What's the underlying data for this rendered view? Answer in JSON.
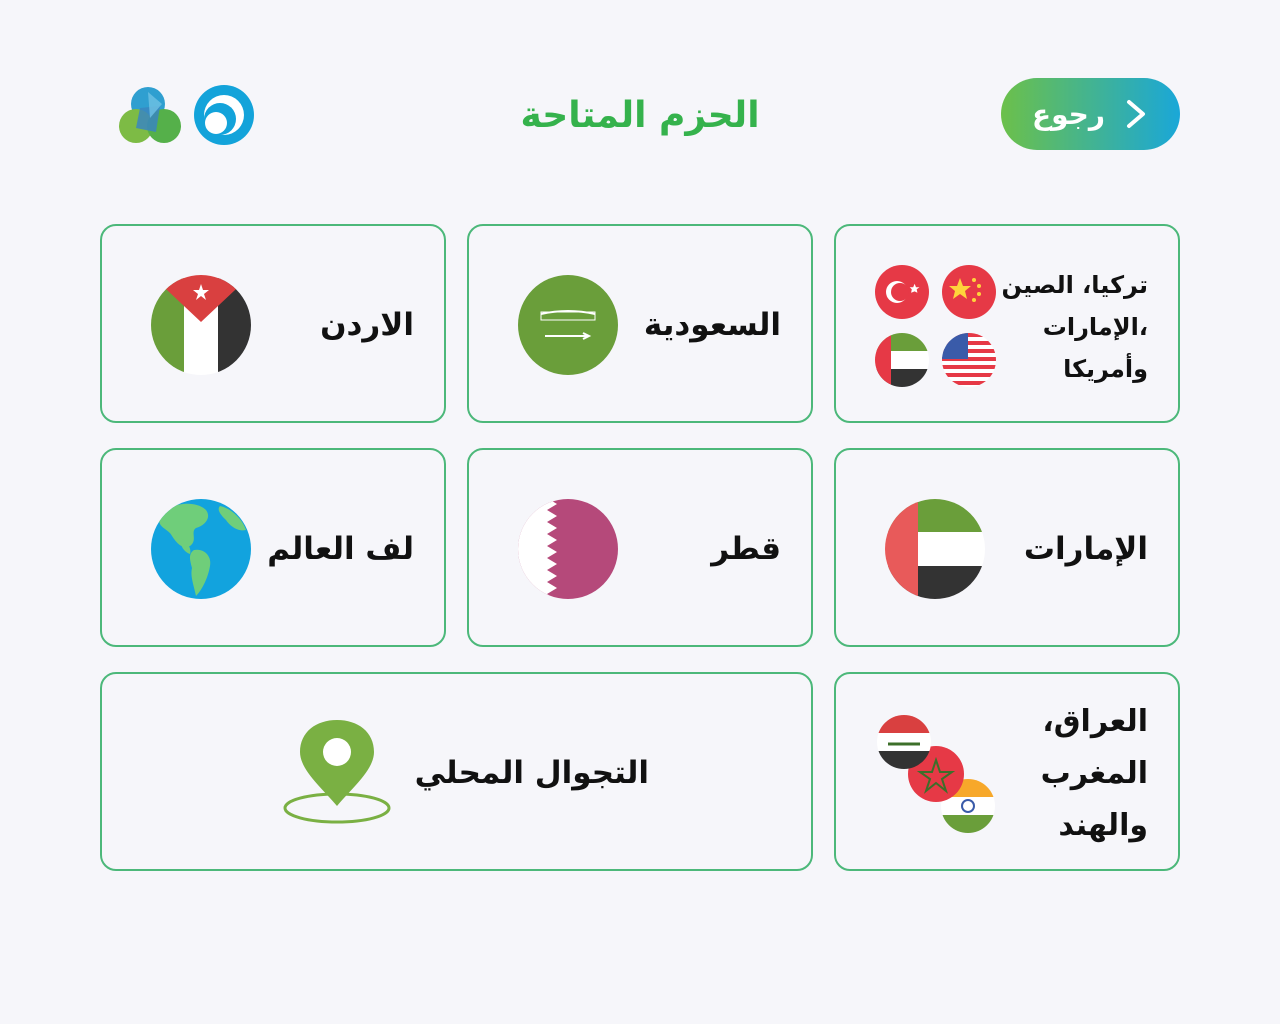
{
  "header": {
    "title": "الحزم المتاحة",
    "back_label": "رجوع",
    "logos": [
      "brand-logo-flower",
      "brand-logo-ring"
    ]
  },
  "colors": {
    "accent_green": "#35b24c",
    "accent_blue": "#1aa7d8",
    "card_border": "#4cb87a"
  },
  "packages": [
    {
      "label": "تركيا، الصين ،الإمارات وأمريكا",
      "lines": [
        "تركيا، الصين",
        "،الإمارات",
        "وأمريكا"
      ],
      "icons": [
        "turkey-flag-icon",
        "china-flag-icon",
        "uae-flag-icon",
        "usa-flag-icon"
      ]
    },
    {
      "label": "السعودية",
      "icons": [
        "saudi-flag-icon"
      ]
    },
    {
      "label": "الاردن",
      "icons": [
        "jordan-flag-icon"
      ]
    },
    {
      "label": "الإمارات",
      "icons": [
        "uae-flag-icon"
      ]
    },
    {
      "label": "قطر",
      "icons": [
        "qatar-flag-icon"
      ]
    },
    {
      "label": "لف العالم",
      "icons": [
        "globe-icon"
      ]
    },
    {
      "label": "العراق، المغرب والهند",
      "lines": [
        "العراق،",
        "المغرب",
        "والهند"
      ],
      "icons": [
        "iraq-flag-icon",
        "morocco-flag-icon",
        "india-flag-icon"
      ]
    },
    {
      "label": "التجوال المحلي",
      "icons": [
        "location-pin-icon"
      ]
    }
  ]
}
